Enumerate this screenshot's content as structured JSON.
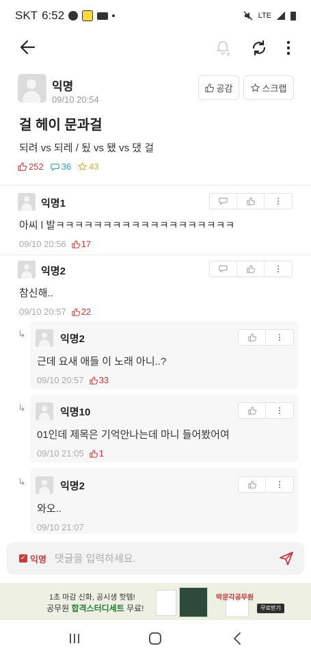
{
  "status_bar": {
    "carrier": "SKT",
    "time": "6:52",
    "network": "LTE"
  },
  "post": {
    "author": "익명",
    "date": "09/10 20:54",
    "title": "걸 헤이 문과걸",
    "body": "되려 vs 되레 / 됬 vs 됐 vs 댔 걸",
    "like_count": "252",
    "comment_count": "36",
    "scrap_count": "43",
    "like_button": "공감",
    "scrap_button": "스크랩"
  },
  "comments": [
    {
      "author": "익명1",
      "text": "아씨 l 발ㅋㅋㅋㅋㅋㅋㅋㅋㅋㅋㅋㅋㅋㅋㅋㅋㅋㅋㅋ",
      "date": "09/10 20:56",
      "likes": "17"
    },
    {
      "author": "익명2",
      "text": "참신해..",
      "date": "09/10 20:57",
      "likes": "22"
    }
  ],
  "replies": [
    {
      "author": "익명2",
      "text": "근데 요새 애들 이 노래 아니..?",
      "date": "09/10 20:57",
      "likes": "33"
    },
    {
      "author": "익명10",
      "text": "01인데 제목은 기억안나는데 마니 들어봤어여",
      "date": "09/10 21:05",
      "likes": "1"
    },
    {
      "author": "익명2",
      "text": "와오..",
      "date": "09/10 21:07",
      "likes": ""
    }
  ],
  "input_bar": {
    "anon_label": "익명",
    "placeholder": "댓글을 입력하세요."
  },
  "ad": {
    "line1": "1초 마감 신화, 공시생 핫템!",
    "line2_prefix": "공무원 ",
    "line2_bold": "합격스터디세트",
    "line2_suffix": " 무료!",
    "brand": "박문각공무원",
    "cta": "무료받기"
  },
  "colors": {
    "accent": "#c63b3b",
    "comment_teal": "#2aa3b4",
    "scrap_gold": "#d9b130"
  }
}
